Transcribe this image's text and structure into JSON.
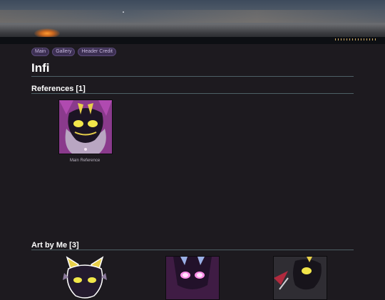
{
  "nav": {
    "items": [
      "Main",
      "Gallery",
      "Header Credit"
    ]
  },
  "page": {
    "title": "Infi"
  },
  "references": {
    "heading": "References [1]",
    "items": [
      {
        "caption": "Main Reference"
      }
    ]
  },
  "art_by_me": {
    "heading": "Art by Me [3]"
  },
  "colors": {
    "background": "#1d1a1f",
    "accent_purple": "#3c2f52",
    "rule": "#4d6066"
  }
}
